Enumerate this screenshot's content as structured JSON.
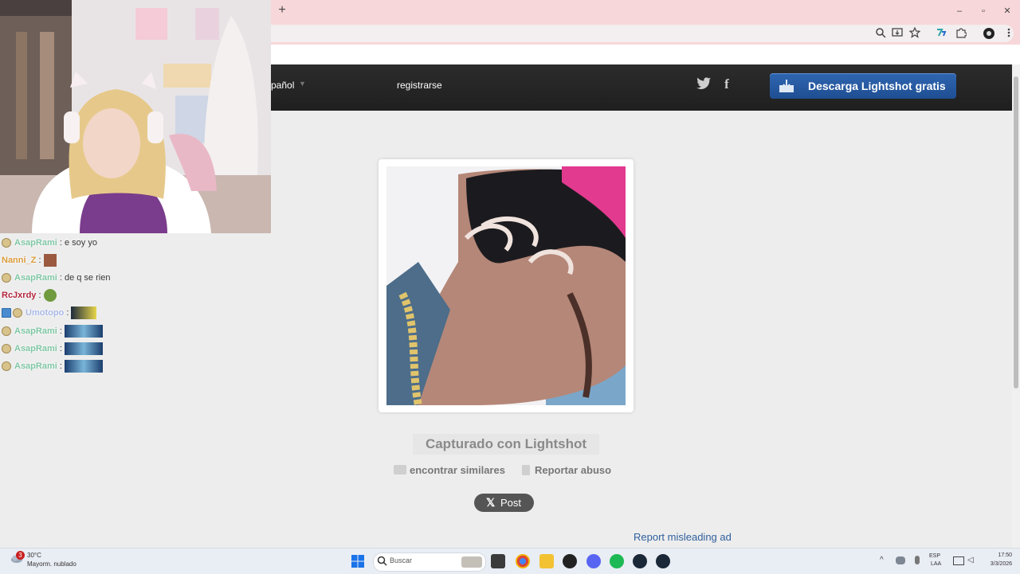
{
  "browser": {
    "new_tab_label": "+",
    "window_controls": {
      "minimize": "–",
      "restore": "▫",
      "close": "✕"
    },
    "toolbar_icons": [
      "zoom-icon",
      "install-icon",
      "star-icon",
      "extension-icon",
      "puzzle-icon",
      "profile-icon",
      "menu-icon"
    ]
  },
  "site": {
    "language": "pañol",
    "register_label": "registrarse",
    "social": {
      "twitter": "twitter-icon",
      "facebook": "f"
    },
    "download_label": "Descarga Lightshot gratis",
    "captured_label": "Capturado con Lightshot",
    "find_similar_label": "encontrar similares",
    "report_abuse_label": "Reportar abuso",
    "post_label": "Post",
    "report_ad_label": "Report misleading ad"
  },
  "chat": [
    {
      "user": "AsapRami",
      "user_color": "#7fc6a4",
      "msg": ": e soy yo",
      "badge": "round"
    },
    {
      "user": "Nanni_Z",
      "user_color": "#d99a3a",
      "msg": ":",
      "badge": "none",
      "emote": "emote-brown"
    },
    {
      "user": "AsapRami",
      "user_color": "#7fc6a4",
      "msg": ": de q se rien",
      "badge": "round"
    },
    {
      "user": "RcJxrdy",
      "user_color": "#b3243c",
      "msg": ":",
      "badge": "none",
      "emote": "emote-frog"
    },
    {
      "user": "Umotopo",
      "user_color": "#a8b7e6",
      "msg": ":",
      "badge": "double",
      "emote": "emote-yellow"
    },
    {
      "user": "AsapRami",
      "user_color": "#7fc6a4",
      "msg": ":",
      "badge": "round",
      "emote": "emote-banner"
    },
    {
      "user": "AsapRami",
      "user_color": "#7fc6a4",
      "msg": ":",
      "badge": "round",
      "emote": "emote-banner"
    },
    {
      "user": "AsapRami",
      "user_color": "#7fc6a4",
      "msg": ":",
      "badge": "round",
      "emote": "emote-banner"
    }
  ],
  "taskbar": {
    "weather_badge": "3",
    "temperature": "30°C",
    "weather_desc": "Mayorm. nublado",
    "search_placeholder": "Buscar",
    "language": "ESP",
    "layout": "LAA",
    "time": "17:50",
    "date": "3/3/2026"
  },
  "colors": {
    "accent": "#2f66b2",
    "header": "#242424",
    "tab_bg": "#f7d7d9"
  }
}
